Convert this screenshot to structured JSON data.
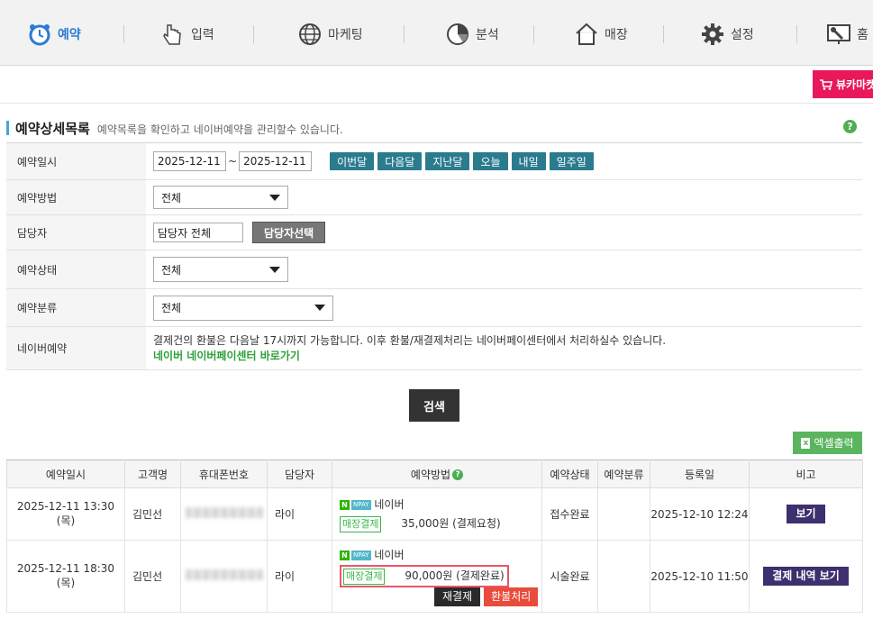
{
  "nav": {
    "items": [
      {
        "label": "예약",
        "icon": "alarm-clock-icon"
      },
      {
        "label": "입력",
        "icon": "hand-pointer-icon"
      },
      {
        "label": "마케팅",
        "icon": "globe-icon"
      },
      {
        "label": "분석",
        "icon": "pie-chart-icon"
      },
      {
        "label": "매장",
        "icon": "house-icon"
      },
      {
        "label": "설정",
        "icon": "gear-icon"
      },
      {
        "label": "홈",
        "icon": "monitor-wrench-icon"
      }
    ],
    "shop_button": "뷰카마켓",
    "accent": "#2a7bd3"
  },
  "section": {
    "title": "예약상세목록",
    "desc": "예약목록을 확인하고 네이버예약을 관리할수 있습니다.",
    "help": "?"
  },
  "filters": {
    "date": {
      "label": "예약일시",
      "from": "2025-12-11",
      "to": "2025-12-11",
      "sep": "~",
      "quick": [
        "이번달",
        "다음달",
        "지난달",
        "오늘",
        "내일",
        "일주일"
      ]
    },
    "method": {
      "label": "예약방법",
      "value": "전체"
    },
    "staff": {
      "label": "담당자",
      "value": "담당자 전체",
      "button": "담당자선택"
    },
    "status": {
      "label": "예약상태",
      "value": "전체"
    },
    "category": {
      "label": "예약분류",
      "value": "전체"
    },
    "naver": {
      "label": "네이버예약",
      "text": "결제건의 환불은 다음날 17시까지 가능합니다. 이후 환불/재결제처리는 네이버페이센터에서 처리하실수 있습니다.",
      "link": "네이버 네이버페이센터 바로가기"
    }
  },
  "search_button": "검색",
  "excel_button": "엑셀출력",
  "table": {
    "headers": [
      "예약일시",
      "고객명",
      "휴대폰번호",
      "담당자",
      "예약방법",
      "예약상태",
      "예약분류",
      "등록일",
      "비고"
    ],
    "rows": [
      {
        "datetime": "2025-12-11 13:30 (목)",
        "name": "김민선",
        "staff": "라이",
        "naver_label": "네이버",
        "n_badge": "N",
        "npay_badge": "NPAY",
        "store_badge": "매장결제",
        "amount": "35,000원 (결제요청)",
        "status": "접수완료",
        "category": "",
        "registered": "2025-12-10 12:24",
        "action": "보기"
      },
      {
        "datetime": "2025-12-11 18:30 (목)",
        "name": "김민선",
        "staff": "라이",
        "naver_label": "네이버",
        "n_badge": "N",
        "npay_badge": "NPAY",
        "store_badge": "매장결제",
        "amount": "90,000원 (결제완료)",
        "repay": "재결제",
        "refund": "환불처리",
        "status": "시술완료",
        "category": "",
        "registered": "2025-12-10 11:50",
        "action": "결제 내역 보기"
      }
    ]
  }
}
